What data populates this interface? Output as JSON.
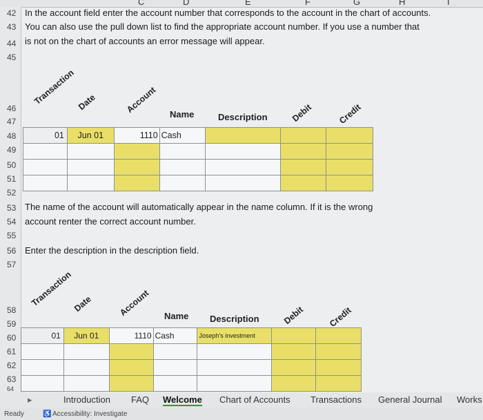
{
  "columns": [
    "C",
    "D",
    "E",
    "F",
    "G",
    "H",
    "I"
  ],
  "row_numbers": [
    "42",
    "43",
    "44",
    "45",
    "46",
    "47",
    "48",
    "49",
    "50",
    "51",
    "52",
    "53",
    "54",
    "55",
    "56",
    "57",
    "58",
    "59",
    "60",
    "61",
    "62",
    "63",
    "64"
  ],
  "instructions": {
    "line1": "In the account field enter the account number that corresponds to the account in the chart of accounts.",
    "line2": "You can also use the pull down list to find the appropriate account number. If you use a number that",
    "line3": "is not on the chart of accounts an error message will appear.",
    "line4": "The name of the account will automatically appear in the name column. If it is the wrong",
    "line5": "account renter the correct account number.",
    "line6": "Enter the description in the description field."
  },
  "headers": {
    "transaction": "Transaction",
    "date": "Date",
    "account": "Account",
    "name": "Name",
    "description": "Description",
    "debit": "Debit",
    "credit": "Credit"
  },
  "entry1": {
    "transaction": "01",
    "date": "Jun 01",
    "account": "1110",
    "name": "Cash",
    "description": ""
  },
  "entry2": {
    "transaction": "01",
    "date": "Jun 01",
    "account": "1110",
    "name": "Cash",
    "description": "Joseph's investment"
  },
  "tabs": [
    "Introduction",
    "FAQ",
    "Welcome",
    "Chart of Accounts",
    "Transactions",
    "General Journal",
    "Works"
  ],
  "active_tab": "Welcome",
  "status": {
    "ready": "Ready",
    "accessibility": "Accessibility: Investigate"
  },
  "colors": {
    "input_cell": "#e9df68",
    "active_tab_underline": "#3c8c3c"
  }
}
